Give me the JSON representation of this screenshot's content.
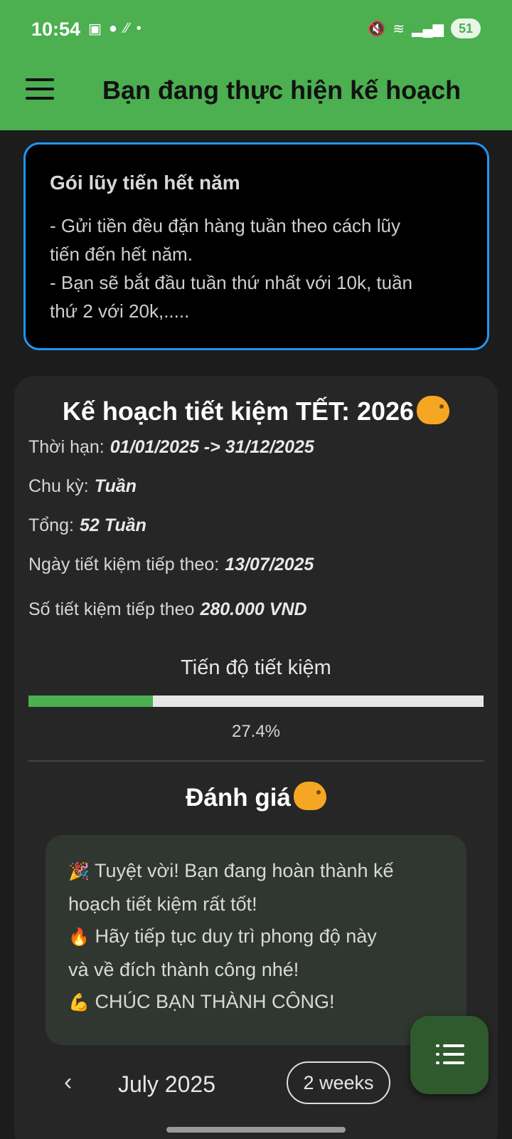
{
  "status_bar": {
    "time": "10:54",
    "battery": "51"
  },
  "app_bar": {
    "title": "Bạn đang thực hiện kế hoạch"
  },
  "info_card": {
    "heading": "Gói lũy tiến hết năm",
    "lines": [
      "- Gửi tiền đều đặn hàng tuần theo cách lũy",
      "tiến đến hết năm.",
      "- Bạn sẽ bắt đầu tuần thứ nhất với 10k, tuần",
      "thứ 2 với 20k,....."
    ]
  },
  "plan": {
    "title": "Kế hoạch tiết kiệm TẾT: 2026",
    "duration_label": "Thời hạn:",
    "duration_value": "01/01/2025 -> 31/12/2025",
    "cycle_label": "Chu kỳ:",
    "cycle_value": "Tuần",
    "total_label": "Tổng:",
    "total_value": "52 Tuần",
    "next_date_label": "Ngày tiết kiệm tiếp theo:",
    "next_date_value": "13/07/2025",
    "next_amount_label": "Số tiết kiệm tiếp theo",
    "next_amount_value": "280.000 VND",
    "progress_label": "Tiến độ tiết kiệm",
    "progress_percent_text": "27.4%",
    "progress_fraction": 0.274,
    "accent_color": "#4caf50"
  },
  "evaluation": {
    "title": "Đánh giá",
    "lines": [
      {
        "emoji": "🎉",
        "text": "Tuyệt vời! Bạn đang hoàn thành kế"
      },
      {
        "emoji": "",
        "text": "hoạch tiết kiệm rất tốt!"
      },
      {
        "emoji": "🔥",
        "text": "Hãy tiếp tục duy trì phong độ này"
      },
      {
        "emoji": "",
        "text": "và về đích thành công nhé!"
      },
      {
        "emoji": "💪",
        "text": "CHÚC BẠN THÀNH CÔNG!"
      }
    ]
  },
  "calendar": {
    "month": "July 2025",
    "format_button": "2 weeks"
  },
  "icons": {
    "menu": "menu-icon",
    "piggy_bank": "piggy-bank-icon",
    "list": "list-icon",
    "chevron_left": "chevron-left-icon",
    "chevron_right": "chevron-right-icon"
  }
}
